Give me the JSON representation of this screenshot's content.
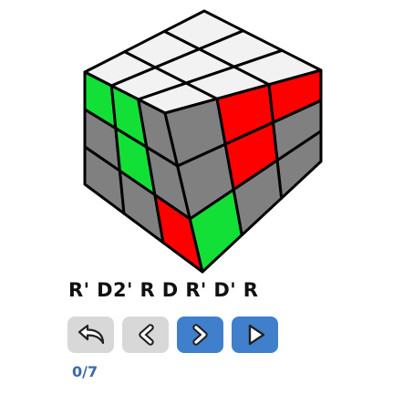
{
  "cube": {
    "colors": {
      "white": "#f2f2f2",
      "green": "#12e036",
      "red": "#ff0000",
      "gray": "#808080",
      "edge": "#000000"
    },
    "faces": {
      "top": [
        [
          "white",
          "white",
          "white"
        ],
        [
          "white",
          "white",
          "white"
        ],
        [
          "white",
          "white",
          "white"
        ]
      ],
      "front": [
        [
          "green",
          "green",
          "gray"
        ],
        [
          "gray",
          "green",
          "gray"
        ],
        [
          "gray",
          "gray",
          "red"
        ]
      ],
      "right": [
        [
          "gray",
          "red",
          "red"
        ],
        [
          "gray",
          "red",
          "gray"
        ],
        [
          "green",
          "gray",
          "gray"
        ]
      ]
    }
  },
  "algorithm": "R' D2' R D R' D' R",
  "controls": {
    "reset_icon": "reset-arrow-icon",
    "prev_icon": "chevron-left-icon",
    "next_icon": "chevron-right-icon",
    "play_icon": "play-triangle-icon"
  },
  "progress": {
    "label": "0/7",
    "current": 0,
    "total": 7
  }
}
